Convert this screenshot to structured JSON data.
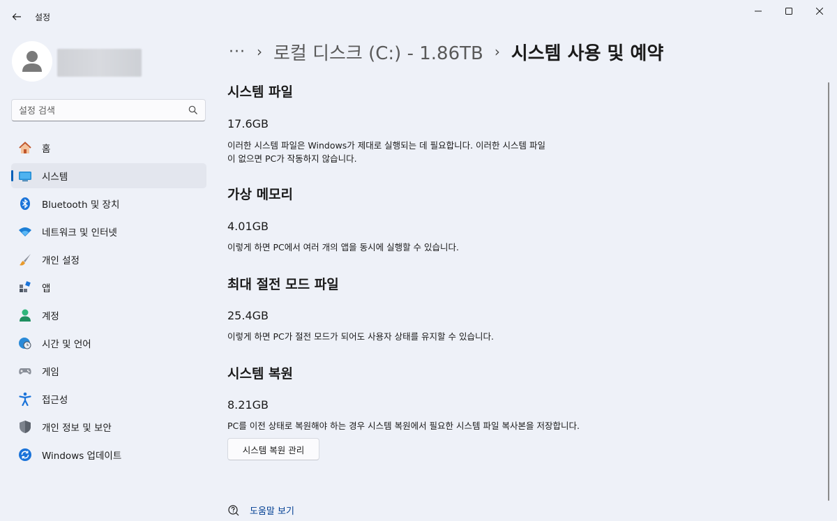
{
  "window": {
    "title": "설정"
  },
  "sidebar": {
    "search_placeholder": "설정 검색",
    "items": [
      {
        "label": "홈",
        "icon": "home-icon"
      },
      {
        "label": "시스템",
        "icon": "system-icon",
        "active": true
      },
      {
        "label": "Bluetooth 및 장치",
        "icon": "bluetooth-icon"
      },
      {
        "label": "네트워크 및 인터넷",
        "icon": "wifi-icon"
      },
      {
        "label": "개인 설정",
        "icon": "brush-icon"
      },
      {
        "label": "앱",
        "icon": "apps-icon"
      },
      {
        "label": "계정",
        "icon": "account-icon"
      },
      {
        "label": "시간 및 언어",
        "icon": "clock-globe-icon"
      },
      {
        "label": "게임",
        "icon": "gamepad-icon"
      },
      {
        "label": "접근성",
        "icon": "accessibility-icon"
      },
      {
        "label": "개인 정보 및 보안",
        "icon": "shield-icon"
      },
      {
        "label": "Windows 업데이트",
        "icon": "update-icon"
      }
    ]
  },
  "breadcrumb": {
    "more": "···",
    "parent": "로컬 디스크 (C:) - 1.86TB",
    "current": "시스템 사용 및 예약"
  },
  "sections": [
    {
      "title": "시스템 파일",
      "size": "17.6GB",
      "description": "이러한 시스템 파일은 Windows가 제대로 실행되는 데 필요합니다. 이러한 시스템 파일이 없으면 PC가 작동하지 않습니다."
    },
    {
      "title": "가상 메모리",
      "size": "4.01GB",
      "description": "이렇게 하면 PC에서 여러 개의 앱을 동시에 실행할 수 있습니다."
    },
    {
      "title": "최대 절전 모드 파일",
      "size": "25.4GB",
      "description": "이렇게 하면 PC가 절전 모드가 되어도 사용자 상태를 유지할 수 있습니다."
    },
    {
      "title": "시스템 복원",
      "size": "8.21GB",
      "description": "PC를 이전 상태로 복원해야 하는 경우 시스템 복원에서 필요한 시스템 파일 복사본을 저장합니다.",
      "button": "시스템 복원 관리"
    }
  ],
  "help": {
    "label": "도움말 보기"
  },
  "colors": {
    "background": "#eef1f8",
    "accent": "#005fb8",
    "link": "#003e92"
  }
}
